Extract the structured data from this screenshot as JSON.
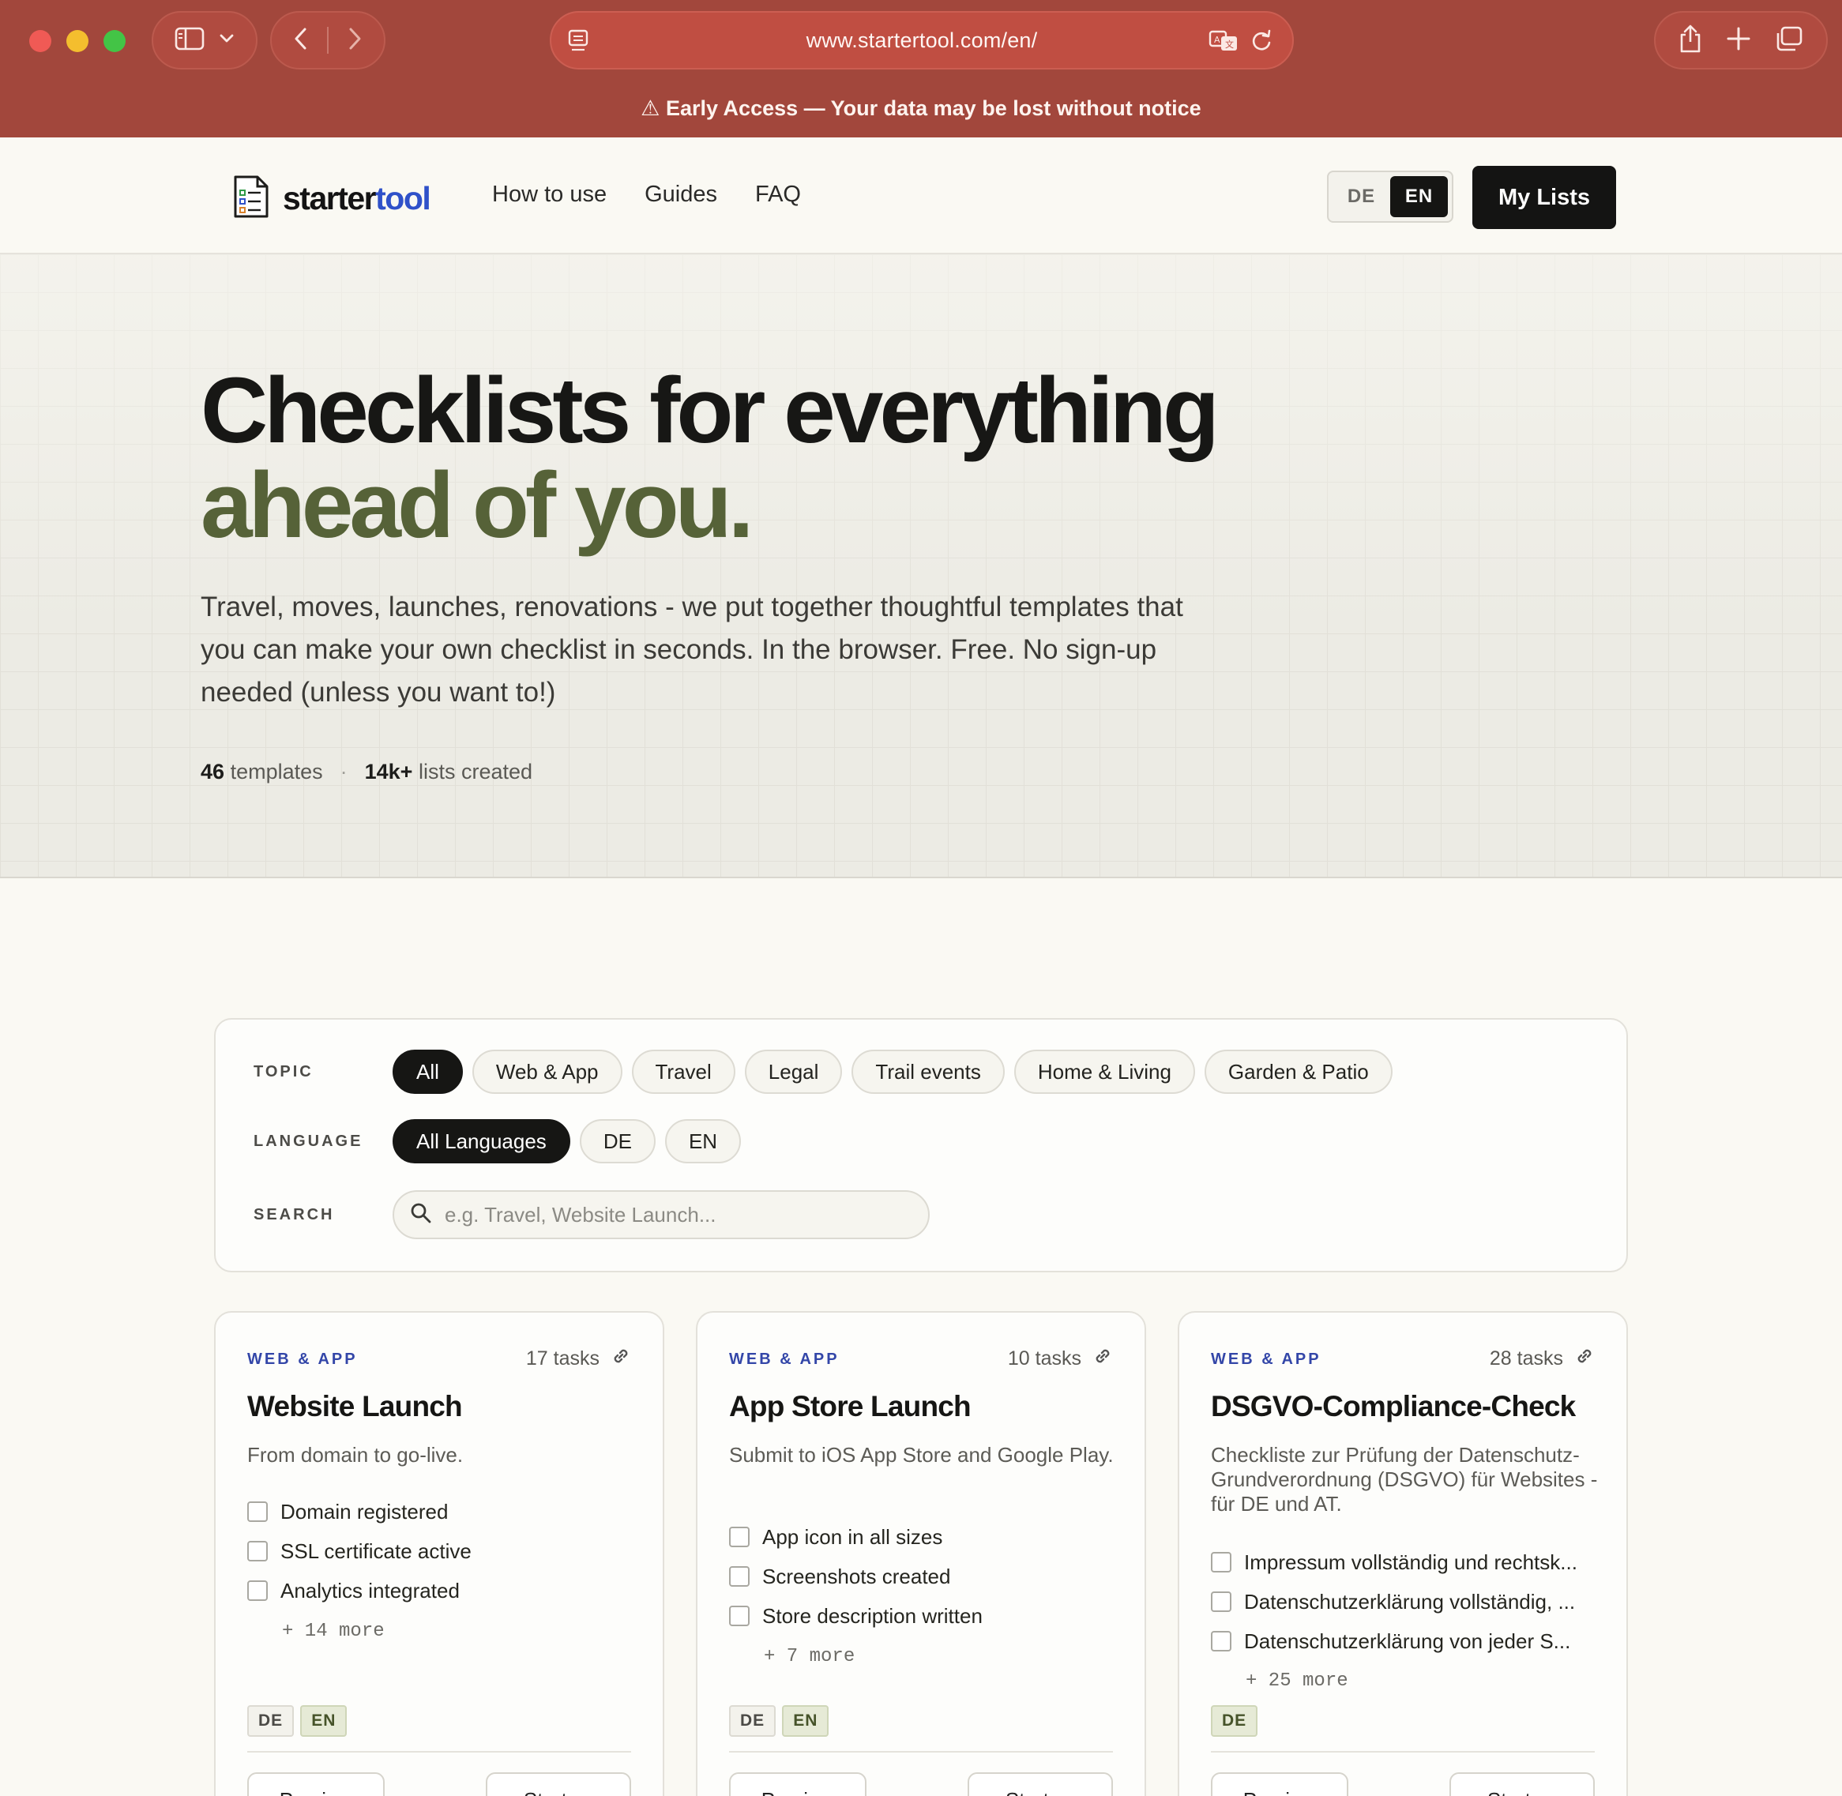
{
  "browser": {
    "url": "www.startertool.com/en/",
    "banner": "⚠ Early Access — Your data may be lost without notice"
  },
  "header": {
    "logo_main": "starter",
    "logo_accent": "tool",
    "nav": [
      "How to use",
      "Guides",
      "FAQ"
    ],
    "lang_options": [
      "DE",
      "EN"
    ],
    "lang_active": "EN",
    "my_lists": "My Lists"
  },
  "hero": {
    "title_line1": "Checklists for everything",
    "title_line2": "ahead of you.",
    "lead": "Travel, moves, launches, renovations - we put together thoughtful templates that you can make your own checklist in seconds. In the browser. Free. No sign-up needed (unless you want to!)",
    "templates_count": "46",
    "templates_label": "templates",
    "separator": "·",
    "lists_count": "14k+",
    "lists_label": "lists created"
  },
  "filters": {
    "topic_label": "TOPIC",
    "topics": [
      "All",
      "Web & App",
      "Travel",
      "Legal",
      "Trail events",
      "Home & Living",
      "Garden & Patio"
    ],
    "topic_active": "All",
    "language_label": "LANGUAGE",
    "languages": [
      "All Languages",
      "DE",
      "EN"
    ],
    "language_active": "All Languages",
    "search_label": "SEARCH",
    "search_placeholder": "e.g. Travel, Website Launch..."
  },
  "cards": [
    {
      "category": "WEB & APP",
      "tasks_count": "17 tasks",
      "title": "Website Launch",
      "description": "From domain to go-live.",
      "tasks": [
        "Domain registered",
        "SSL certificate active",
        "Analytics integrated"
      ],
      "more": "+ 14 more",
      "langs": [
        "DE",
        "EN"
      ],
      "preview": "Preview",
      "start": "Start →"
    },
    {
      "category": "WEB & APP",
      "tasks_count": "10 tasks",
      "title": "App Store Launch",
      "description": "Submit to iOS App Store and Google Play.",
      "tasks": [
        "App icon in all sizes",
        "Screenshots created",
        "Store description written"
      ],
      "more": "+ 7 more",
      "langs": [
        "DE",
        "EN"
      ],
      "preview": "Preview",
      "start": "Start →"
    },
    {
      "category": "WEB & APP",
      "tasks_count": "28 tasks",
      "title": "DSGVO-Compliance-Check",
      "description": "Checkliste zur Prüfung der Datenschutz-Grundverordnung (DSGVO) für Websites - für DE und AT.",
      "tasks": [
        "Impressum vollständig und rechtsk...",
        "Datenschutzerklärung vollständig, ...",
        "Datenschutzerklärung von jeder S..."
      ],
      "more": "+ 25 more",
      "langs": [
        "DE"
      ],
      "preview": "Preview",
      "start": "Start →"
    }
  ]
}
